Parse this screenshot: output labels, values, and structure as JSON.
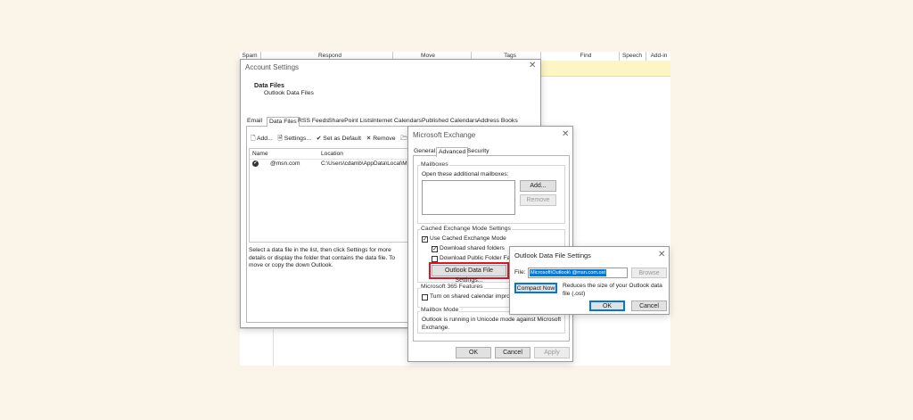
{
  "ribbon": {
    "groups": [
      "Spam",
      "Respond",
      "Move",
      "Tags",
      "Find",
      "Speech",
      "Add-in"
    ]
  },
  "account_settings": {
    "title": "Account Settings",
    "header_title": "Data Files",
    "header_subtitle": "Outlook Data Files",
    "tabs": [
      "Email",
      "Data Files",
      "RSS Feeds",
      "SharePoint Lists",
      "Internet Calendars",
      "Published Calendars",
      "Address Books"
    ],
    "toolbar": {
      "add": "Add...",
      "settings": "Settings...",
      "set_default": "Set as Default",
      "remove": "Remove",
      "open": "Op"
    },
    "columns": [
      "Name",
      "Location"
    ],
    "rows": [
      {
        "name": "@msn.com",
        "location": "C:\\Users\\cdamb\\AppData\\Local\\Mic"
      }
    ],
    "help_text": "Select a data file in the list, then click Settings for more details or display the folder that contains the data file. To move or copy the down Outlook."
  },
  "exchange": {
    "title": "Microsoft Exchange",
    "tabs": [
      "General",
      "Advanced",
      "Security"
    ],
    "mailboxes_label": "Mailboxes",
    "open_additional": "Open these additional mailboxes:",
    "add_button": "Add...",
    "remove_button": "Remove",
    "cached_label": "Cached Exchange Mode Settings",
    "use_cached": "Use Cached Exchange Mode",
    "download_shared": "Download shared folders",
    "download_public": "Download Public Folder Favor",
    "ods_button": "Outlook Data File Settings...",
    "m365_label": "Microsoft 365 Features",
    "turn_on_shared": "Turn on shared calendar improve",
    "mailbox_mode_label": "Mailbox Mode",
    "mailbox_mode_text": "Outlook is running in Unicode mode against Microsoft Exchange.",
    "ok": "OK",
    "cancel": "Cancel",
    "apply": "Apply"
  },
  "ods": {
    "title": "Outlook Data File Settings",
    "file_label": "File:",
    "file_value": "Microsoft\\Outlook\\        @msn.com.ost",
    "browse": "Browse",
    "compact": "Compact Now",
    "compact_desc": "Reduces the size of your Outlook data file (.ost)",
    "ok": "OK",
    "cancel": "Cancel"
  },
  "colors": {
    "background": "#fbf5e9",
    "accent": "#0078d7",
    "highlight": "#e81123",
    "selection": "#0078d7"
  }
}
